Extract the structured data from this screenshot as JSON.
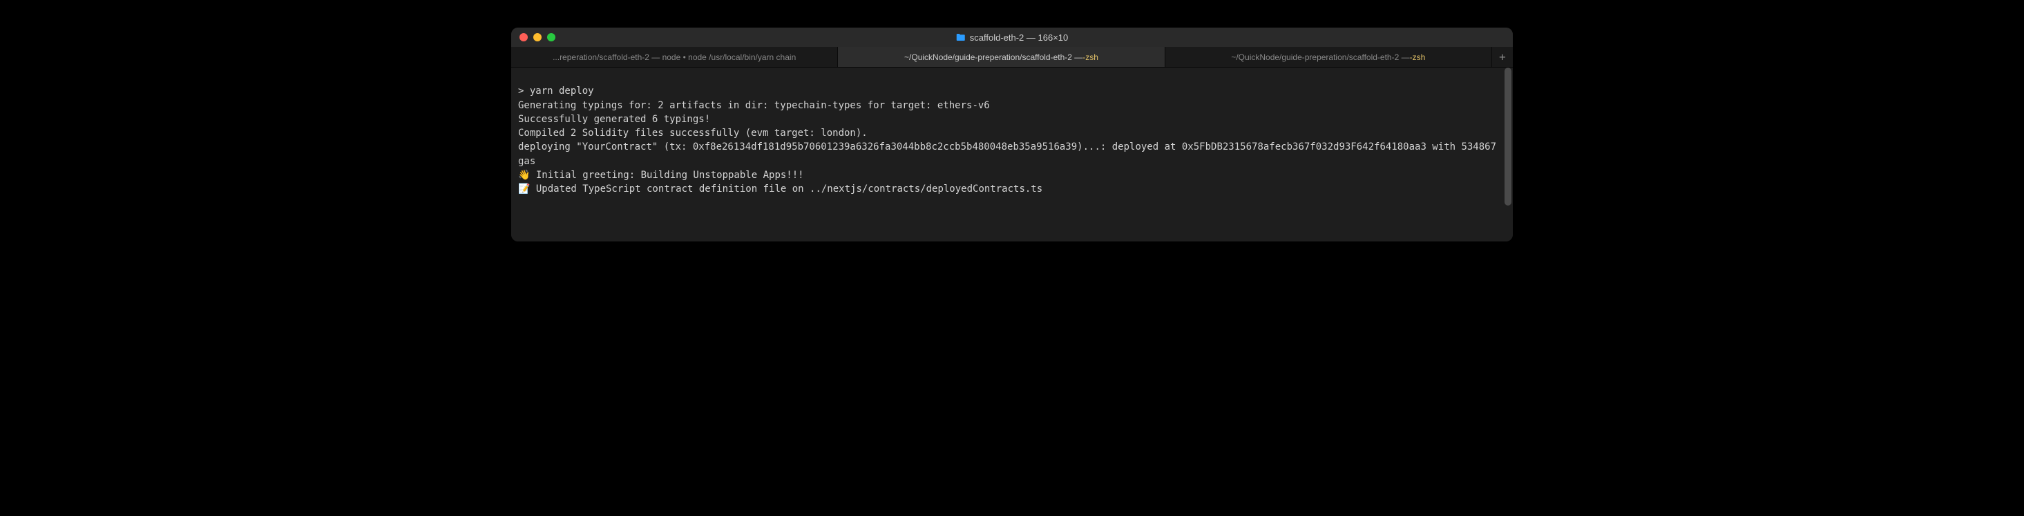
{
  "window": {
    "title": "scaffold-eth-2 — 166×10",
    "folder_icon": "📁"
  },
  "tabs": [
    {
      "label": "...reperation/scaffold-eth-2 — node • node /usr/local/bin/yarn chain",
      "active": false
    },
    {
      "label_prefix": "~/QuickNode/guide-preperation/scaffold-eth-2 — ",
      "label_suffix": "-zsh",
      "active": true
    },
    {
      "label_prefix": "~/QuickNode/guide-preperation/scaffold-eth-2 — ",
      "label_suffix": "-zsh",
      "active": false
    }
  ],
  "add_tab": "+",
  "terminal": {
    "prompt": "> ",
    "command": "yarn deploy",
    "lines": [
      "Generating typings for: 2 artifacts in dir: typechain-types for target: ethers-v6",
      "Successfully generated 6 typings!",
      "Compiled 2 Solidity files successfully (evm target: london).",
      "deploying \"YourContract\" (tx: 0xf8e26134df181d95b70601239a6326fa3044bb8c2ccb5b480048eb35a9516a39)...: deployed at 0x5FbDB2315678afecb367f032d93F642f64180aa3 with 534867 gas",
      "👋 Initial greeting: Building Unstoppable Apps!!!",
      "📝 Updated TypeScript contract definition file on ../nextjs/contracts/deployedContracts.ts"
    ]
  }
}
